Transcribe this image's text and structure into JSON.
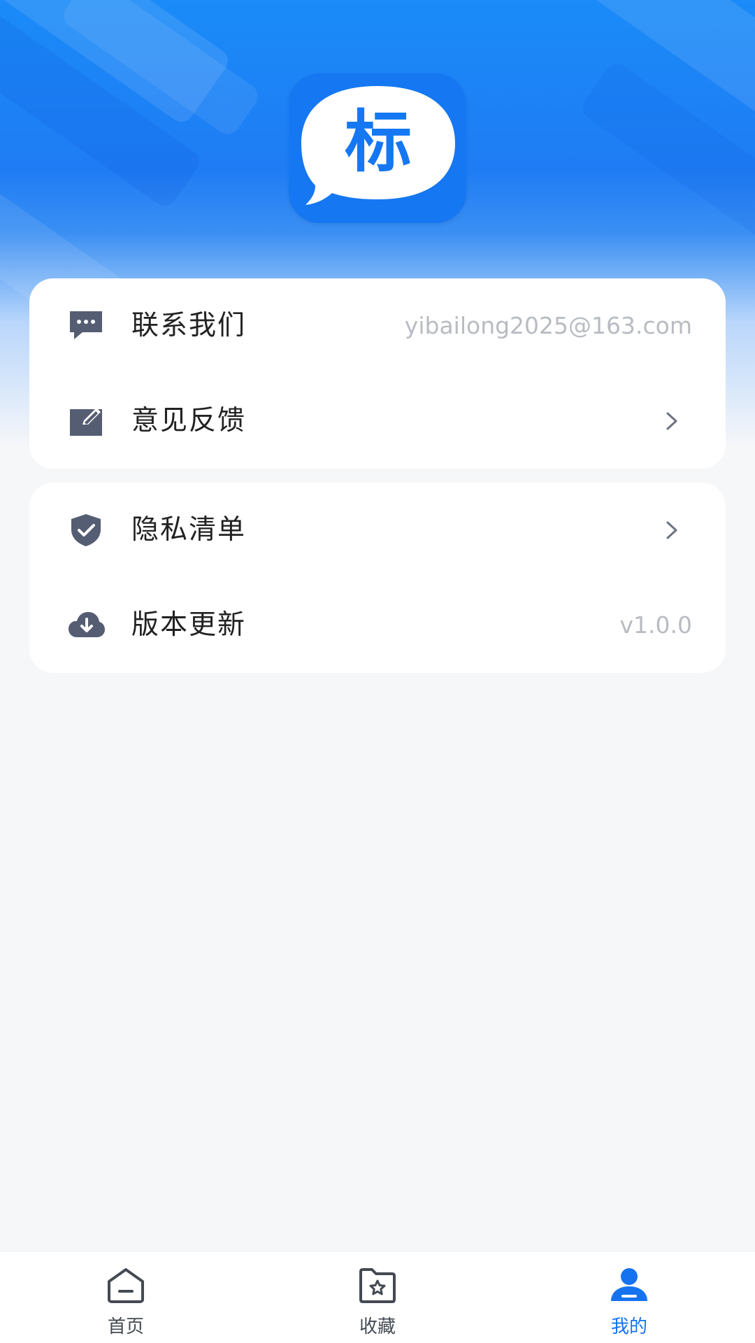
{
  "app": {
    "logo_glyph": "标",
    "brand_color": "#1577f2"
  },
  "menu_groups": [
    {
      "items": [
        {
          "label": "联系我们",
          "value": "yibailong2025@163.com",
          "icon": "message-icon"
        },
        {
          "label": "意见反馈",
          "icon": "edit-icon",
          "has_chevron": true
        }
      ]
    },
    {
      "items": [
        {
          "label": "隐私清单",
          "icon": "shield-check-icon",
          "has_chevron": true
        },
        {
          "label": "版本更新",
          "value": "v1.0.0",
          "icon": "cloud-download-icon"
        }
      ]
    }
  ],
  "tabbar": {
    "tabs": [
      {
        "label": "首页",
        "icon": "home-icon",
        "active": false
      },
      {
        "label": "收藏",
        "icon": "favorites-folder-icon",
        "active": false
      },
      {
        "label": "我的",
        "icon": "user-icon",
        "active": true
      }
    ],
    "active_color": "#1573f0",
    "inactive_color": "#444a53"
  }
}
